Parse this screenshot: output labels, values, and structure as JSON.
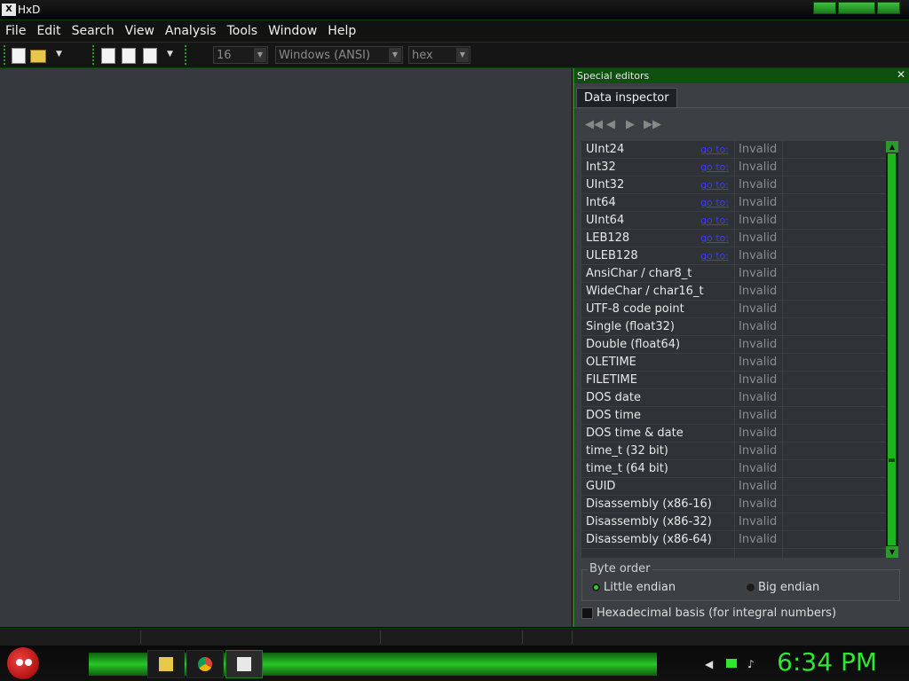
{
  "window": {
    "icon_text": "X",
    "title": "HxD"
  },
  "menu": [
    "File",
    "Edit",
    "Search",
    "View",
    "Analysis",
    "Tools",
    "Window",
    "Help"
  ],
  "toolbar": {
    "bytes_per_row": "16",
    "charset": "Windows (ANSI)",
    "offset_base": "hex"
  },
  "panel": {
    "title": "Special editors",
    "close_glyph": "✕",
    "tab": "Data inspector",
    "nav": [
      "◀◀",
      "◀",
      "▶",
      "▶▶"
    ],
    "rows": [
      {
        "label": "UInt24",
        "link": "go to:",
        "value": "Invalid"
      },
      {
        "label": "Int32",
        "link": "go to:",
        "value": "Invalid"
      },
      {
        "label": "UInt32",
        "link": "go to:",
        "value": "Invalid"
      },
      {
        "label": "Int64",
        "link": "go to:",
        "value": "Invalid"
      },
      {
        "label": "UInt64",
        "link": "go to:",
        "value": "Invalid"
      },
      {
        "label": "LEB128",
        "link": "go to:",
        "value": "Invalid"
      },
      {
        "label": "ULEB128",
        "link": "go to:",
        "value": "Invalid"
      },
      {
        "label": "AnsiChar / char8_t",
        "link": "",
        "value": "Invalid"
      },
      {
        "label": "WideChar / char16_t",
        "link": "",
        "value": "Invalid"
      },
      {
        "label": "UTF-8 code point",
        "link": "",
        "value": "Invalid"
      },
      {
        "label": "Single (float32)",
        "link": "",
        "value": "Invalid"
      },
      {
        "label": "Double (float64)",
        "link": "",
        "value": "Invalid"
      },
      {
        "label": "OLETIME",
        "link": "",
        "value": "Invalid"
      },
      {
        "label": "FILETIME",
        "link": "",
        "value": "Invalid"
      },
      {
        "label": "DOS date",
        "link": "",
        "value": "Invalid"
      },
      {
        "label": "DOS time",
        "link": "",
        "value": "Invalid"
      },
      {
        "label": "DOS time & date",
        "link": "",
        "value": "Invalid"
      },
      {
        "label": "time_t (32 bit)",
        "link": "",
        "value": "Invalid"
      },
      {
        "label": "time_t (64 bit)",
        "link": "",
        "value": "Invalid"
      },
      {
        "label": "GUID",
        "link": "",
        "value": "Invalid"
      },
      {
        "label": "Disassembly (x86-16)",
        "link": "",
        "value": "Invalid"
      },
      {
        "label": "Disassembly (x86-32)",
        "link": "",
        "value": "Invalid"
      },
      {
        "label": "Disassembly (x86-64)",
        "link": "",
        "value": "Invalid"
      }
    ],
    "byte_order": {
      "title": "Byte order",
      "little": "Little endian",
      "big": "Big endian",
      "selected": "little"
    },
    "hex_basis_label": "Hexadecimal basis (for integral numbers)",
    "hex_basis_checked": false
  },
  "taskbar": {
    "clock": "6:34 PM",
    "apps": [
      "folder-icon",
      "chrome-icon",
      "hxd-icon"
    ],
    "active_app": "hxd-icon"
  }
}
